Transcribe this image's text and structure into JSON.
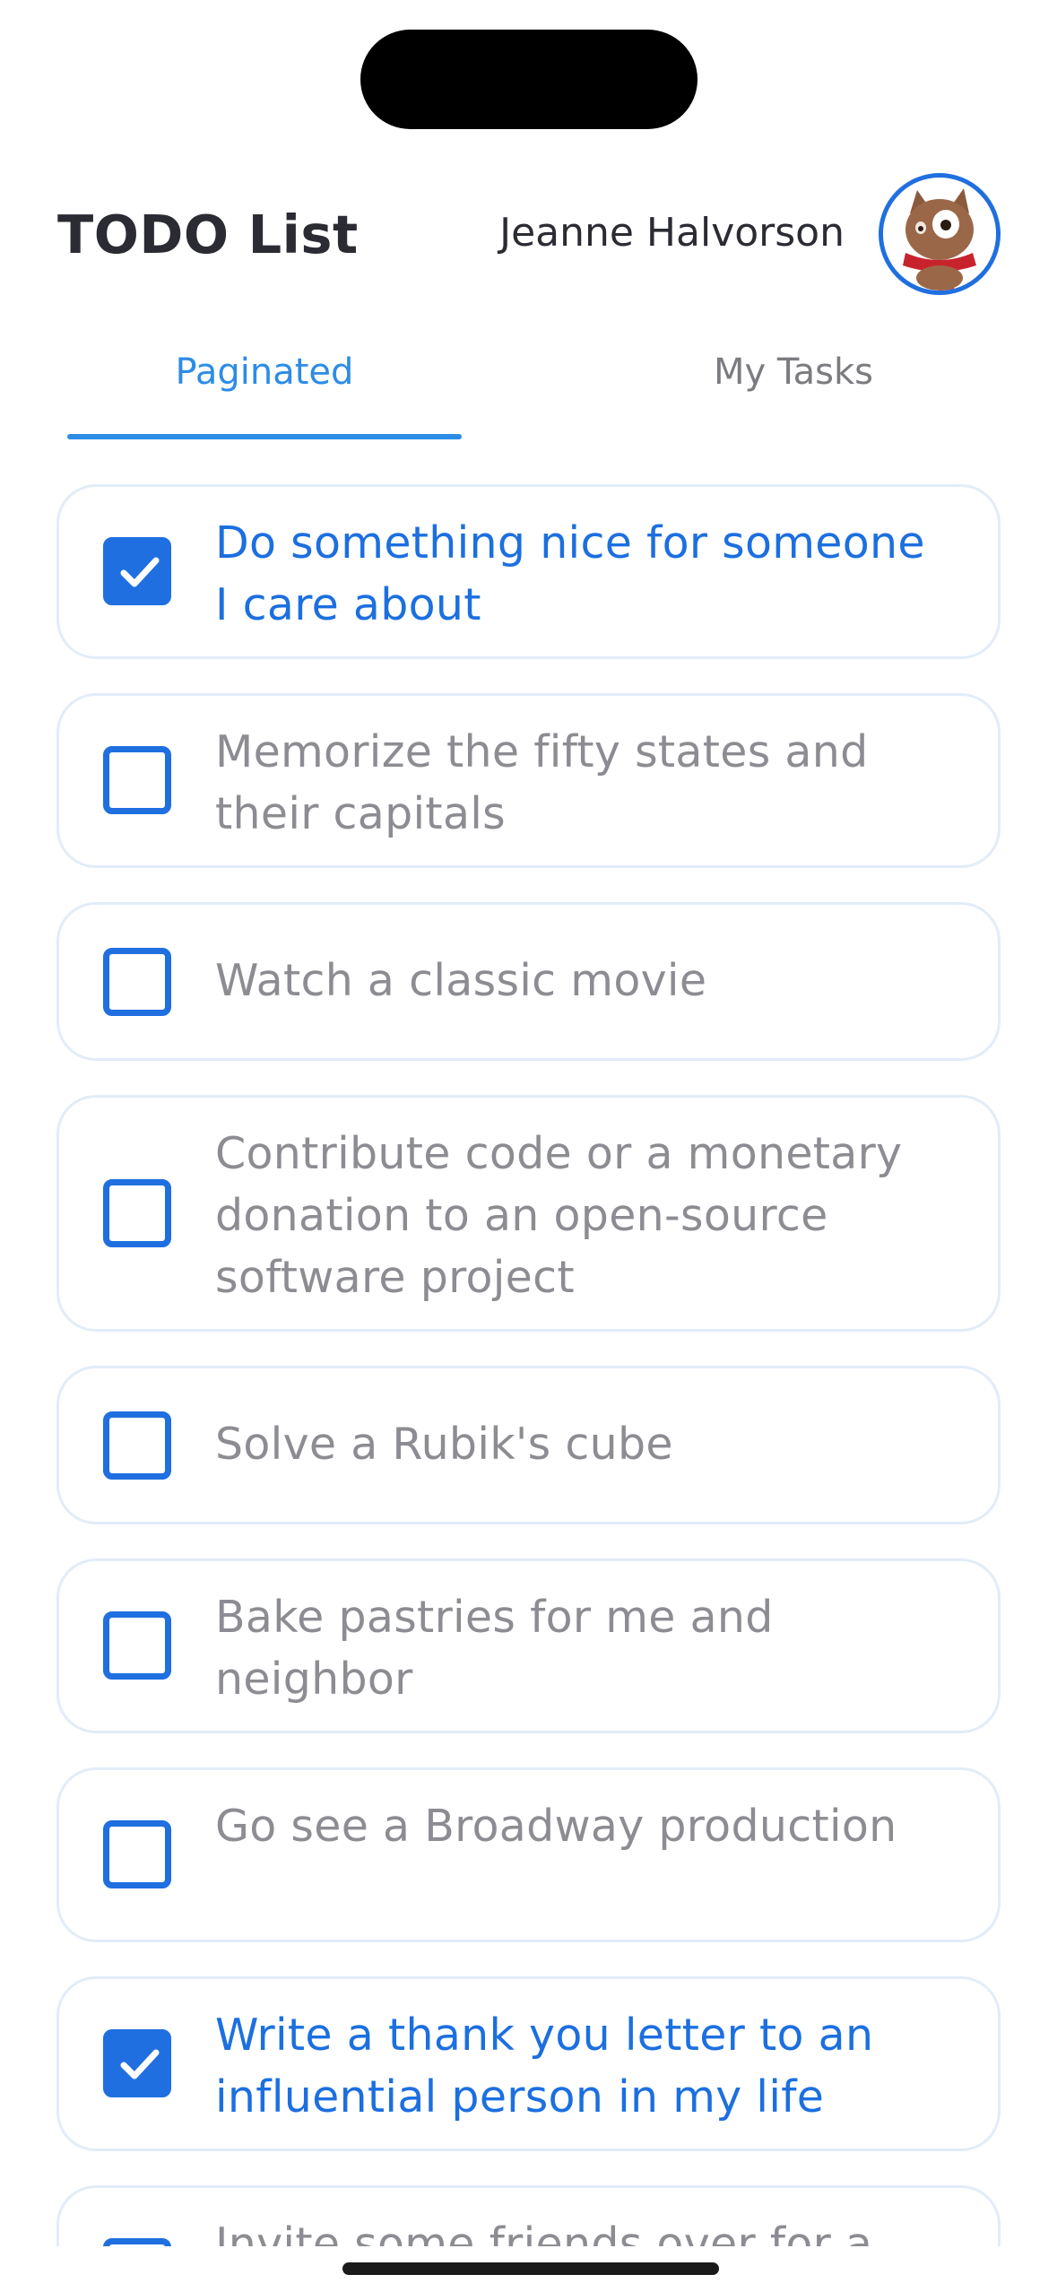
{
  "header": {
    "title": "TODO List",
    "user_name": "Jeanne Halvorson"
  },
  "tabs": [
    {
      "label": "Paginated",
      "active": true
    },
    {
      "label": "My Tasks",
      "active": false
    }
  ],
  "todos": [
    {
      "text": "Do something nice for someone I care about",
      "completed": true
    },
    {
      "text": "Memorize the fifty states and their capitals",
      "completed": false
    },
    {
      "text": "Watch a classic movie",
      "completed": false
    },
    {
      "text": "Contribute code or a monetary donation to an open-source software project",
      "completed": false
    },
    {
      "text": "Solve a Rubik's cube",
      "completed": false
    },
    {
      "text": "Bake pastries for me and neighbor",
      "completed": false
    },
    {
      "text": "Go see a Broadway production",
      "completed": false
    },
    {
      "text": "Write a thank you letter to an influential person in my life",
      "completed": true
    },
    {
      "text": "Invite some friends over for a",
      "completed": false
    }
  ],
  "colors": {
    "accent": "#1f6fe0",
    "tab_active": "#2d8ce6",
    "text_completed": "#1c6fe0",
    "text_pending": "#8c8c92",
    "card_border": "#e3ecf8"
  }
}
